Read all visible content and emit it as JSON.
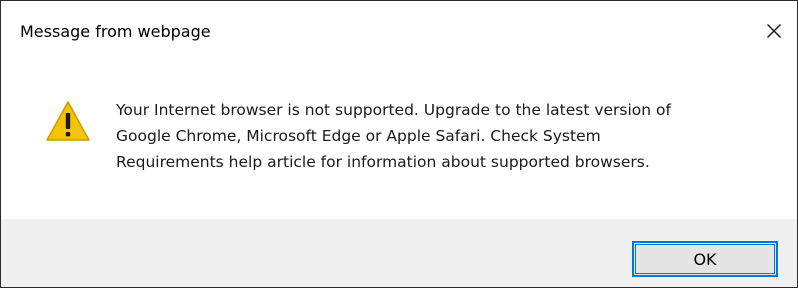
{
  "dialog": {
    "title": "Message from webpage",
    "close_icon": "close-icon",
    "icon": "warning-icon",
    "message_lines": [
      "Your Internet browser is not supported. Upgrade to the latest version of",
      "Google Chrome, Microsoft Edge or Apple Safari. Check System",
      "Requirements help article for information about supported browsers."
    ],
    "ok_label": "OK"
  },
  "colors": {
    "warning_fill": "#f5c400",
    "button_focus_border": "#0078d7",
    "footer_background": "#f0f0f0"
  }
}
